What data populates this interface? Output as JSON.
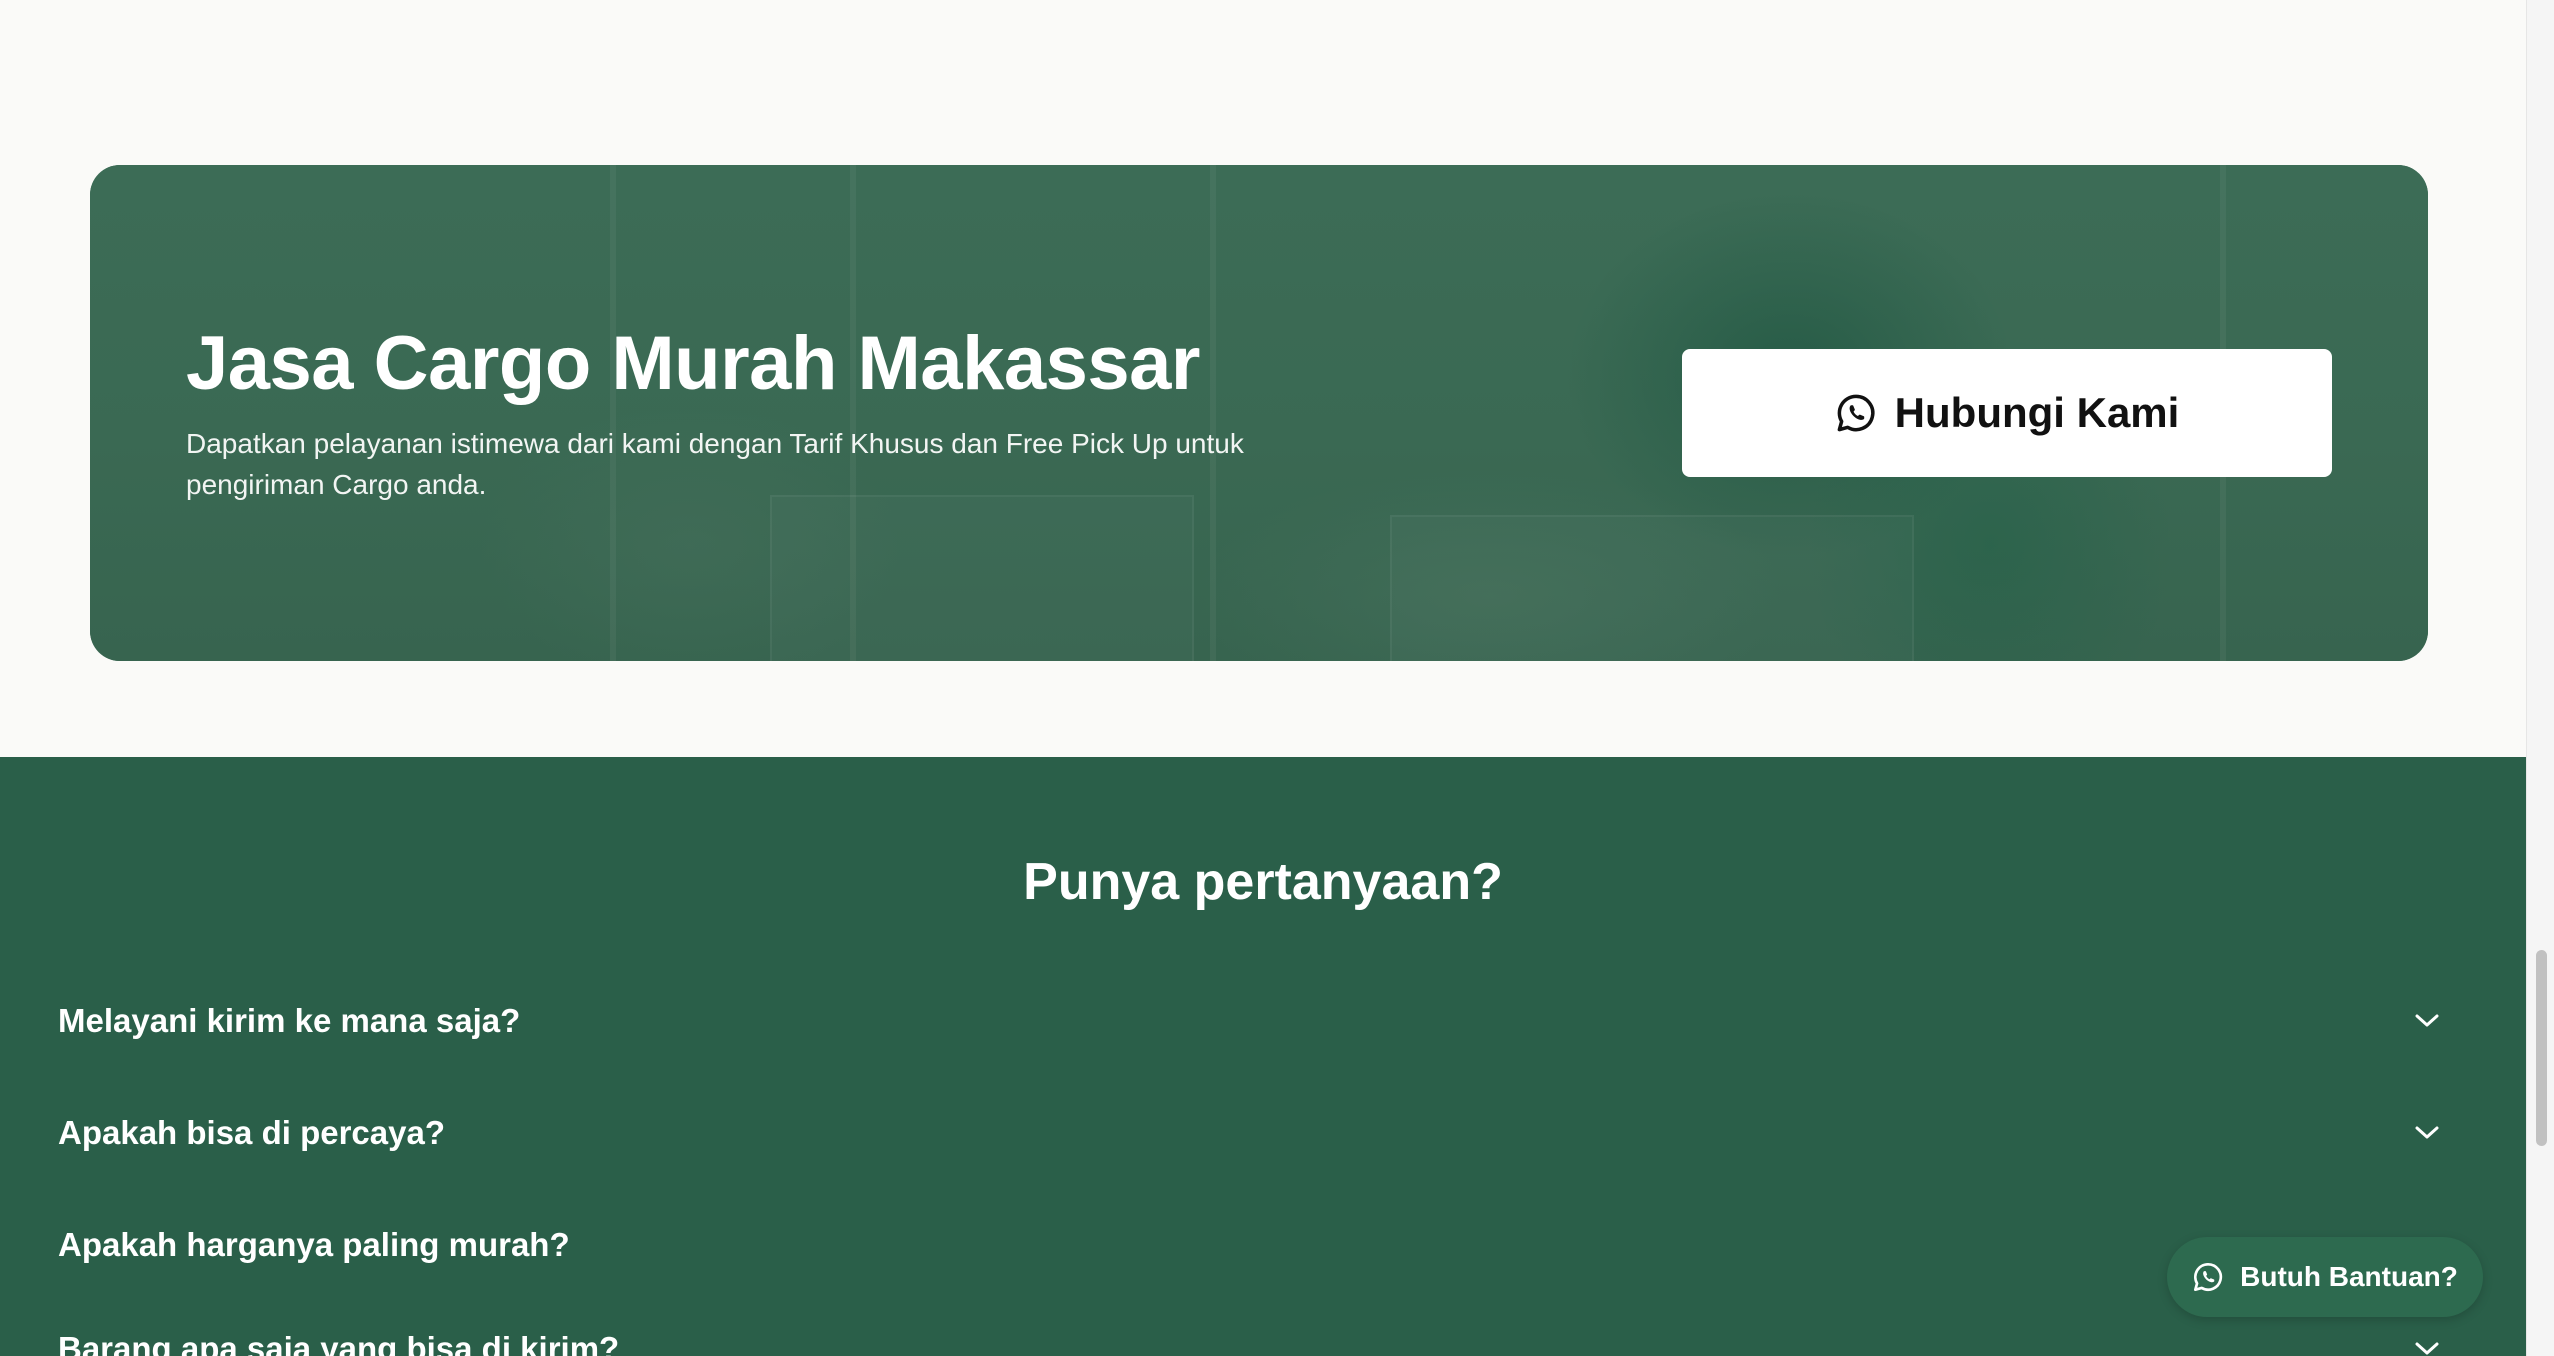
{
  "cta": {
    "title": "Jasa Cargo Murah Makassar",
    "description": "Dapatkan pelayanan istimewa dari kami dengan Tarif Khusus dan Free Pick Up untuk pengiriman Cargo anda.",
    "button_label": "Hubungi Kami",
    "button_icon": "whatsapp-icon"
  },
  "faq": {
    "title": "Punya pertanyaan?",
    "items": [
      {
        "question": "Melayani kirim ke mana saja?"
      },
      {
        "question": "Apakah bisa di percaya?"
      },
      {
        "question": "Apakah harganya paling murah?"
      },
      {
        "question": "Barang apa saja yang bisa di kirim?"
      }
    ],
    "chevron_icon": "chevron-down-icon"
  },
  "help_button": {
    "label": "Butuh Bantuan?",
    "icon": "whatsapp-icon"
  },
  "colors": {
    "page_background": "#fafaf8",
    "banner_green": "#3a6a54",
    "faq_background": "#2a5f49",
    "help_button": "#2d6a4f",
    "button_white": "#ffffff"
  }
}
